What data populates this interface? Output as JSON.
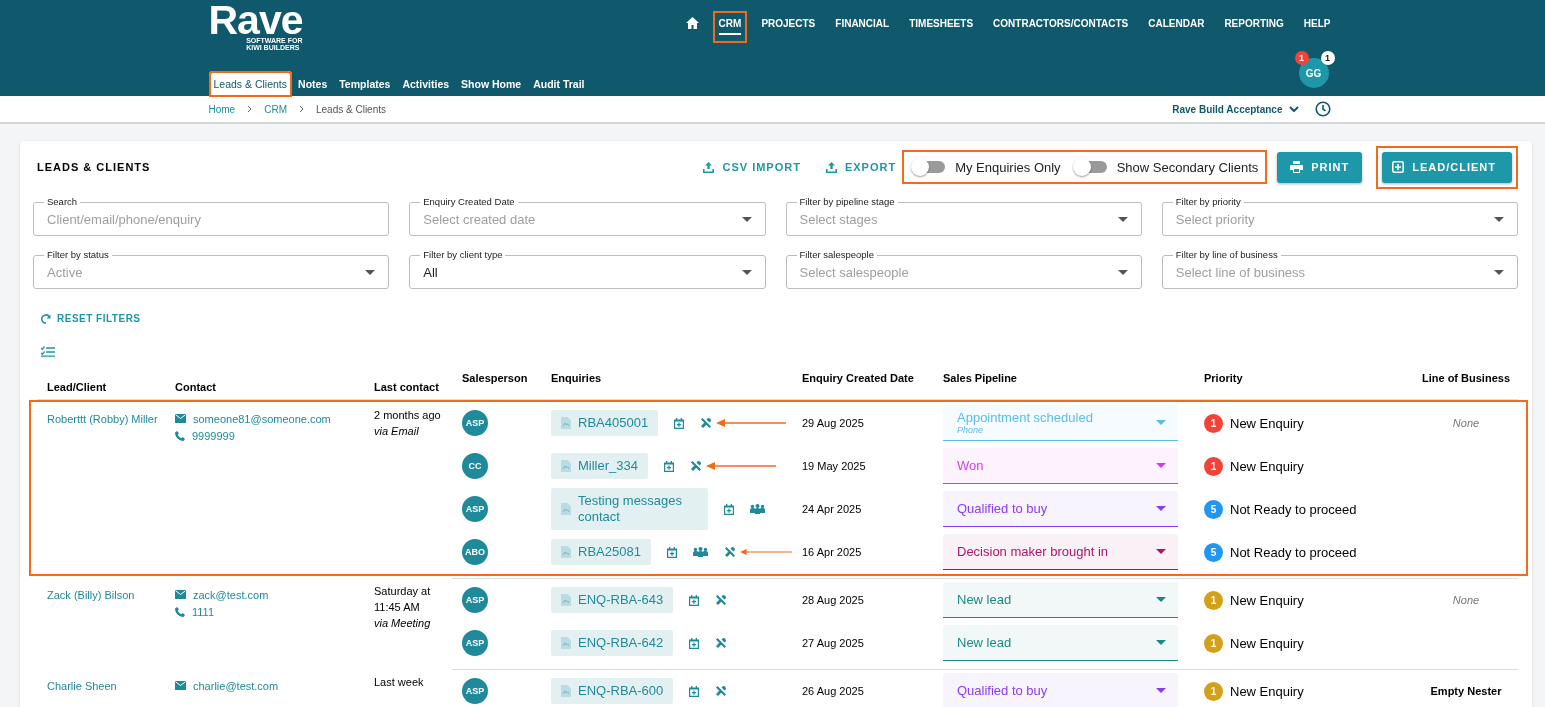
{
  "logo": {
    "name": "Rave",
    "tagline": [
      "SOFTWARE FOR",
      "KIWI BUILDERS"
    ]
  },
  "nav": [
    {
      "kind": "home",
      "selected": false,
      "highlighted": false
    },
    {
      "kind": "link",
      "label": "CRM",
      "selected": true,
      "highlighted": true
    },
    {
      "kind": "link",
      "label": "PROJECTS",
      "selected": false,
      "highlighted": false
    },
    {
      "kind": "link",
      "label": "FINANCIAL",
      "selected": false,
      "highlighted": false
    },
    {
      "kind": "link",
      "label": "TIMESHEETS",
      "selected": false,
      "highlighted": false
    },
    {
      "kind": "link",
      "label": "CONTRACTORS/CONTACTS",
      "selected": false,
      "highlighted": false
    },
    {
      "kind": "link",
      "label": "CALENDAR",
      "selected": false,
      "highlighted": false
    },
    {
      "kind": "link",
      "label": "REPORTING",
      "selected": false,
      "highlighted": false
    },
    {
      "kind": "link",
      "label": "HELP",
      "selected": false,
      "highlighted": false
    }
  ],
  "subnav": [
    {
      "label": "Leads & Clients",
      "selected": true,
      "highlighted": true
    },
    {
      "label": "Notes",
      "selected": false,
      "highlighted": false
    },
    {
      "label": "Templates",
      "selected": false,
      "highlighted": false
    },
    {
      "label": "Activities",
      "selected": false,
      "highlighted": false
    },
    {
      "label": "Show Home",
      "selected": false,
      "highlighted": false
    },
    {
      "label": "Audit Trail",
      "selected": false,
      "highlighted": false
    }
  ],
  "user": {
    "initials": "GG",
    "badges": [
      {
        "count": "1",
        "color": "#f44336"
      },
      {
        "count": "1",
        "color": "#ffffff"
      }
    ]
  },
  "breadcrumb": [
    "Home",
    "CRM",
    "Leads & Clients"
  ],
  "company": "Rave Build Acceptance",
  "panel": {
    "title": "LEADS & CLIENTS",
    "actions": [
      {
        "label": "CSV IMPORT"
      },
      {
        "label": "EXPORT"
      }
    ],
    "toggles_highlighted": true,
    "toggles": [
      {
        "label": "My Enquiries Only",
        "on": false
      },
      {
        "label": "Show Secondary Clients",
        "on": false
      }
    ],
    "buttons": [
      {
        "kind": "print",
        "label": "PRINT",
        "highlighted": false
      },
      {
        "kind": "add",
        "label": "LEAD/CLIENT",
        "highlighted": true
      }
    ],
    "filters": [
      {
        "kind": "text",
        "label": "Search",
        "placeholder": "Client/email/phone/enquiry"
      },
      {
        "kind": "select",
        "label": "Enquiry Created Date",
        "placeholder": "Select created date"
      },
      {
        "kind": "select",
        "label": "Filter by pipeline stage",
        "placeholder": "Select stages"
      },
      {
        "kind": "select",
        "label": "Filter by priority",
        "placeholder": "Select priority"
      },
      {
        "kind": "select",
        "label": "Filter by status",
        "placeholder": "Active"
      },
      {
        "kind": "select",
        "label": "Filter by client type",
        "value": "All"
      },
      {
        "kind": "select",
        "label": "Filter salespeople",
        "placeholder": "Select salespeople"
      },
      {
        "kind": "select",
        "label": "Filter by line of business",
        "placeholder": "Select line of business"
      }
    ],
    "reset": "RESET FILTERS"
  },
  "table": {
    "columns": [
      "Lead/Client",
      "Contact",
      "Last contact",
      "Salesperson",
      "Enquiries",
      "Enquiry Created Date",
      "Sales Pipeline",
      "Priority",
      "Line of Business"
    ],
    "clients": [
      {
        "name": "Roberttt (Robby) Miller",
        "email": "someone81@someone.com",
        "phone": "9999999",
        "last_contact": "2 months ago",
        "via": "via Email",
        "highlighted": true,
        "enquiries": [
          {
            "salesperson": "ASP",
            "ref": "RBA405001",
            "actions": [
              {
                "kind": "calendar"
              },
              {
                "kind": "tools"
              }
            ],
            "annotated": true,
            "date": "29 Aug 2025",
            "pipeline": {
              "stage": "Appointment scheduled",
              "sub": "Phone",
              "color": "#5bbde6"
            },
            "priority": {
              "number": "1",
              "label": "New Enquiry",
              "color": "#f44336"
            },
            "line_of_business": "None",
            "lob_empty": true
          },
          {
            "salesperson": "CC",
            "ref": "Miller_334",
            "actions": [
              {
                "kind": "calendar"
              },
              {
                "kind": "tools"
              }
            ],
            "annotated": true,
            "date": "19 May 2025",
            "pipeline": {
              "stage": "Won",
              "color": "#d63ae8"
            },
            "priority": {
              "number": "1",
              "label": "New Enquiry",
              "color": "#f44336"
            }
          },
          {
            "salesperson": "ASP",
            "ref": "Testing messages contact",
            "actions": [
              {
                "kind": "calendar"
              },
              {
                "kind": "people"
              }
            ],
            "annotated": false,
            "date": "24 Apr 2025",
            "pipeline": {
              "stage": "Qualified to buy",
              "color": "#8a3cf0"
            },
            "priority": {
              "number": "5",
              "label": "Not Ready to proceed",
              "color": "#2196f3"
            }
          },
          {
            "salesperson": "ABO",
            "ref": "RBA25081",
            "actions": [
              {
                "kind": "calendar"
              },
              {
                "kind": "people"
              },
              {
                "kind": "tools"
              }
            ],
            "annotated": true,
            "date": "16 Apr 2025",
            "pipeline": {
              "stage": "Decision maker brought in",
              "color": "#a8176a"
            },
            "priority": {
              "number": "5",
              "label": "Not Ready to proceed",
              "color": "#2196f3"
            }
          }
        ]
      },
      {
        "name": "Zack (Billy) Bilson",
        "email": "zack@test.com",
        "phone": "1111",
        "last_contact": "Saturday at 11:45 AM",
        "via": "via Meeting",
        "highlighted": false,
        "enquiries": [
          {
            "salesperson": "ASP",
            "ref": "ENQ-RBA-643",
            "actions": [
              {
                "kind": "calendar"
              },
              {
                "kind": "tools"
              }
            ],
            "annotated": false,
            "date": "28 Aug 2025",
            "pipeline": {
              "stage": "New lead",
              "color": "#1a8a80"
            },
            "priority": {
              "number": "1",
              "label": "New Enquiry",
              "color": "#d4a017"
            },
            "line_of_business": "None",
            "lob_empty": true
          },
          {
            "salesperson": "ASP",
            "ref": "ENQ-RBA-642",
            "actions": [
              {
                "kind": "calendar"
              },
              {
                "kind": "tools"
              }
            ],
            "annotated": false,
            "date": "27 Aug 2025",
            "pipeline": {
              "stage": "New lead",
              "color": "#1a8a80"
            },
            "priority": {
              "number": "1",
              "label": "New Enquiry",
              "color": "#d4a017"
            }
          }
        ]
      },
      {
        "name": "Charlie Sheen",
        "email": "charlie@test.com",
        "last_contact": "Last week",
        "highlighted": false,
        "enquiries": [
          {
            "salesperson": "ASP",
            "ref": "ENQ-RBA-600",
            "actions": [
              {
                "kind": "calendar"
              },
              {
                "kind": "tools"
              }
            ],
            "annotated": false,
            "date": "26 Aug 2025",
            "pipeline": {
              "stage": "Qualified to buy",
              "color": "#8a3cf0"
            },
            "priority": {
              "number": "1",
              "label": "New Enquiry",
              "color": "#d4a017"
            },
            "line_of_business": "Empty Nester",
            "lob_empty": false
          }
        ]
      }
    ]
  }
}
